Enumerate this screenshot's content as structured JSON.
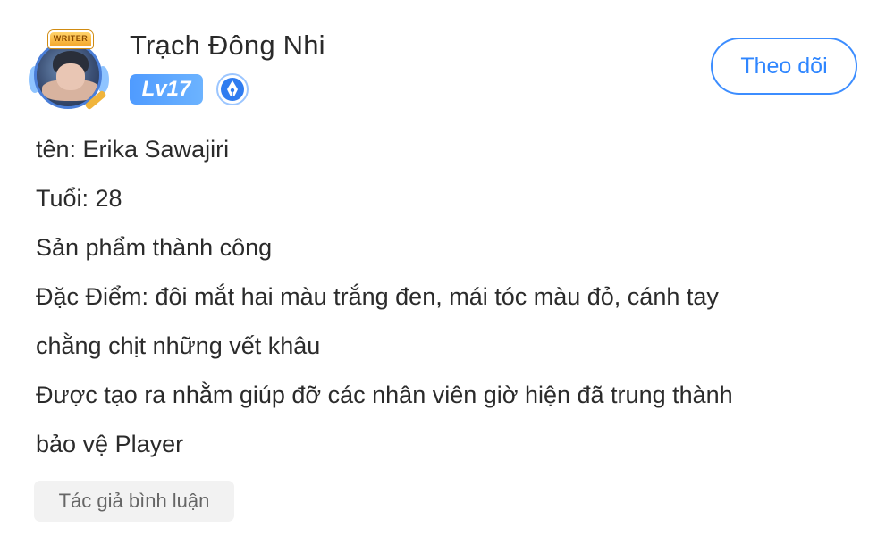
{
  "header": {
    "avatar_badge_text": "WRITER",
    "username": "Trạch Đông Nhi",
    "level": "Lv17",
    "follow_label": "Theo dõi"
  },
  "colors": {
    "accent": "#2f86ff",
    "level_badge": "#5aa6ff",
    "tag_bg": "#f2f2f2"
  },
  "icons": {
    "writer": "pen-nib-badge-icon"
  },
  "content": {
    "lines": [
      "tên: Erika Sawajiri",
      "Tuổi: 28",
      "Sản phẩm thành công",
      "Đặc Điểm: đôi mắt hai màu trắng đen, mái tóc màu đỏ, cánh tay",
      "chằng chịt những vết khâu",
      "Được tạo ra nhằm giúp đỡ các nhân viên giờ hiện đã trung thành",
      "bảo vệ Player"
    ]
  },
  "footer": {
    "author_comment_tag": "Tác giả bình luận"
  }
}
